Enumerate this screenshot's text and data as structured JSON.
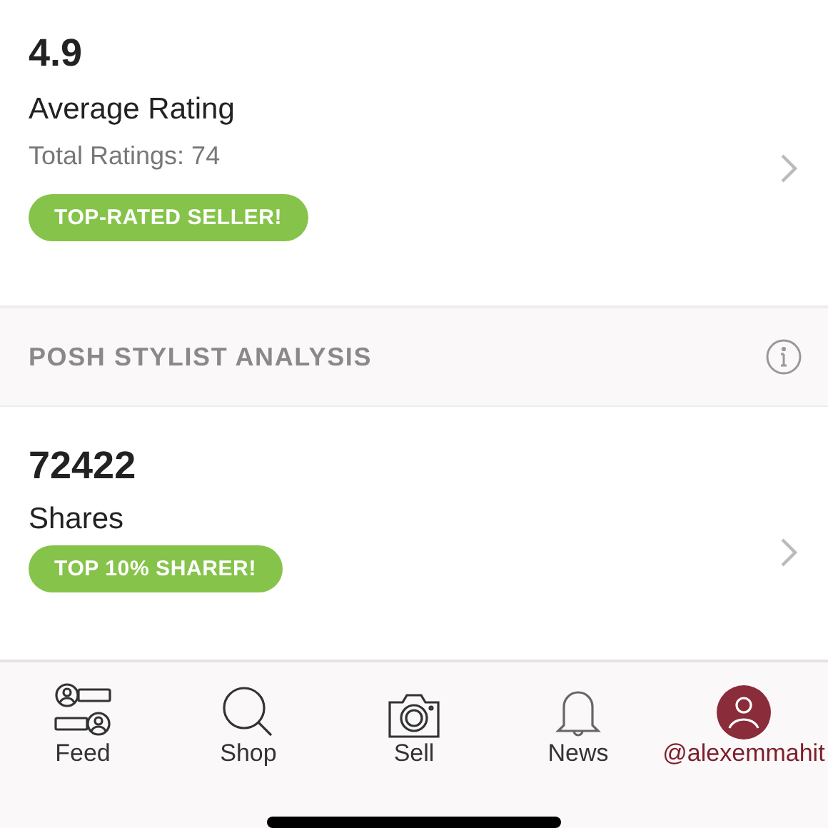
{
  "cards": [
    {
      "value": "4.9",
      "label": "Average Rating",
      "sublabel": "Total Ratings: 74",
      "badge": "TOP-RATED SELLER!"
    },
    {
      "value": "72422",
      "label": "Shares",
      "badge": "TOP 10% SHARER!"
    }
  ],
  "section_header": {
    "title": "POSH STYLIST ANALYSIS"
  },
  "tab_bar": [
    {
      "kind": "feed",
      "label": "Feed",
      "selected": false
    },
    {
      "kind": "shop",
      "label": "Shop",
      "selected": false
    },
    {
      "kind": "sell",
      "label": "Sell",
      "selected": false
    },
    {
      "kind": "news",
      "label": "News",
      "selected": false
    },
    {
      "kind": "profile",
      "label": "@alexemmahit",
      "selected": true
    }
  ]
}
